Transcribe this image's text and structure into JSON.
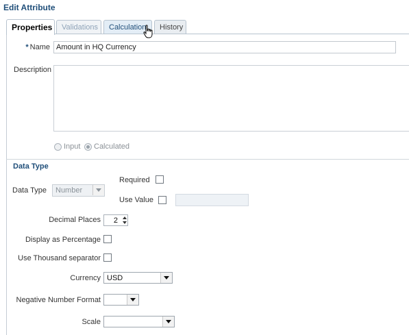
{
  "title": "Edit Attribute",
  "tabs": [
    {
      "label": "Properties",
      "state": "active"
    },
    {
      "label": "Validations",
      "state": "disabled"
    },
    {
      "label": "Calculation",
      "state": "hover"
    },
    {
      "label": "History",
      "state": "normal"
    }
  ],
  "name_field": {
    "required_marker": "*",
    "label": "Name",
    "value": "Amount in HQ Currency"
  },
  "description_field": {
    "label": "Description",
    "value": ""
  },
  "mode": {
    "options": [
      "Input",
      "Calculated"
    ],
    "selected": "Calculated"
  },
  "data_type_section": {
    "title": "Data Type",
    "data_type": {
      "label": "Data Type",
      "value": "Number"
    },
    "required": {
      "label": "Required",
      "checked": false
    },
    "use_value": {
      "label": "Use Value",
      "checked": false,
      "value": ""
    },
    "decimal_places": {
      "label": "Decimal Places",
      "value": "2"
    },
    "display_percentage": {
      "label": "Display as Percentage",
      "checked": false
    },
    "thousand_separator": {
      "label": "Use Thousand separator",
      "checked": false
    },
    "currency": {
      "label": "Currency",
      "value": "USD"
    },
    "negative_format": {
      "label": "Negative Number Format",
      "value": ""
    },
    "scale": {
      "label": "Scale",
      "value": ""
    }
  },
  "colors": {
    "accent": "#1f4e79",
    "tab_border": "#b7c3cf"
  },
  "icons": {
    "cursor": "hand-pointer-icon"
  }
}
